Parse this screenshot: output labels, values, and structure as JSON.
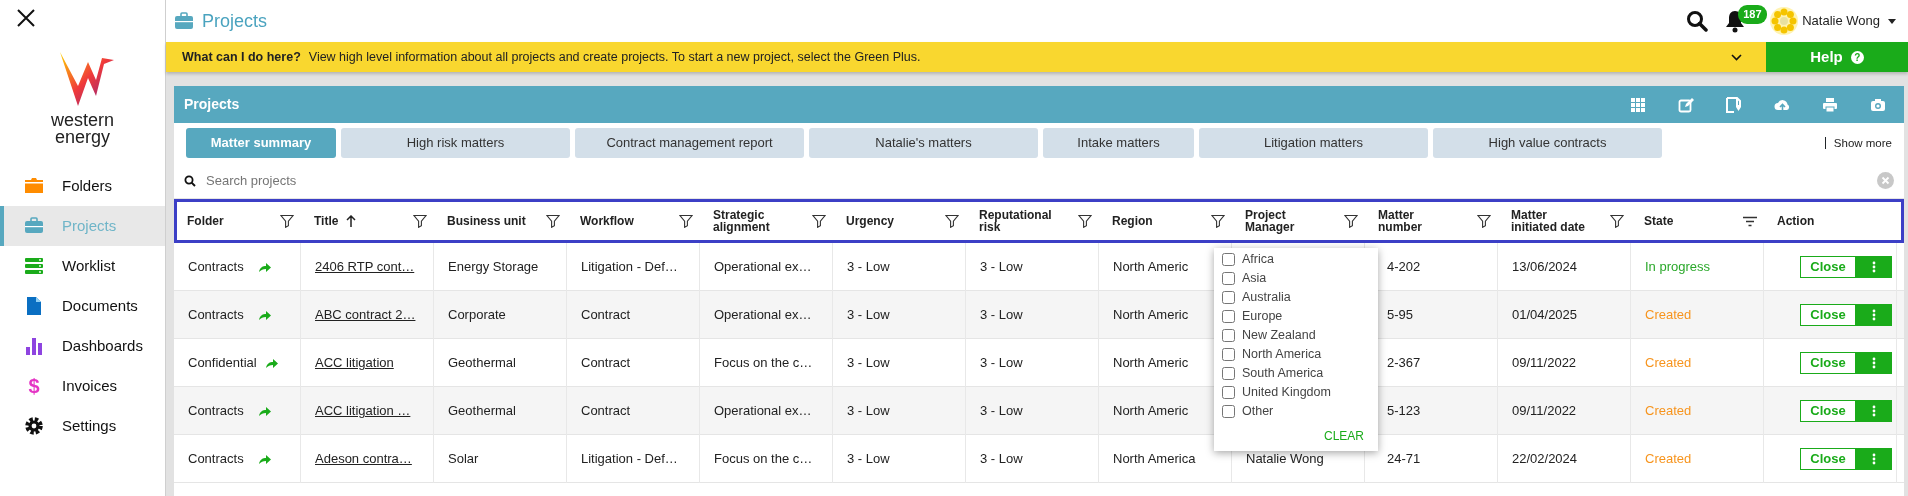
{
  "sidebar": {
    "logo": {
      "line1": "western",
      "line2": "energy"
    },
    "items": [
      {
        "label": "Folders",
        "selected": false
      },
      {
        "label": "Projects",
        "selected": true
      },
      {
        "label": "Worklist",
        "selected": false
      },
      {
        "label": "Documents",
        "selected": false
      },
      {
        "label": "Dashboards",
        "selected": false
      },
      {
        "label": "Invoices",
        "selected": false,
        "glyph": "$"
      },
      {
        "label": "Settings",
        "selected": false
      }
    ]
  },
  "top_bar": {
    "title": "Projects",
    "notification_count": "187",
    "user_name": "Natalie Wong"
  },
  "banner": {
    "lead": "What can I do here?",
    "text": "View high level information about all projects and create projects. To start a new project, select the Green Plus.",
    "help": {
      "label": "Help",
      "glyph": "?"
    }
  },
  "panel": {
    "title": "Projects",
    "tabs": [
      {
        "label": "Matter summary",
        "selected": true
      },
      {
        "label": "High risk matters",
        "selected": false
      },
      {
        "label": "Contract management report",
        "selected": false
      },
      {
        "label": "Natalie's matters",
        "selected": false
      },
      {
        "label": "Intake matters",
        "selected": false
      },
      {
        "label": "Litigation matters",
        "selected": false
      },
      {
        "label": "High value contracts",
        "selected": false
      }
    ],
    "show_more": "Show more",
    "search": {
      "placeholder": "Search projects"
    }
  },
  "table": {
    "columns": [
      {
        "label": "Folder",
        "kind": "funnel",
        "sorted": false
      },
      {
        "label": "Title",
        "kind": "funnel",
        "sorted": true
      },
      {
        "label": "Business unit",
        "kind": "funnel",
        "sorted": false
      },
      {
        "label": "Workflow",
        "kind": "funnel",
        "sorted": false
      },
      {
        "label": "Strategic alignment",
        "kind": "funnel",
        "sorted": false
      },
      {
        "label": "Urgency",
        "kind": "funnel",
        "sorted": false
      },
      {
        "label": "Reputational risk",
        "kind": "funnel",
        "sorted": false
      },
      {
        "label": "Region",
        "kind": "funnel",
        "sorted": false
      },
      {
        "label": "Project Manager",
        "kind": "funnel",
        "sorted": false
      },
      {
        "label": "Matter number",
        "kind": "funnel",
        "sorted": false
      },
      {
        "label": "Matter initiated date",
        "kind": "funnel",
        "sorted": false
      },
      {
        "label": "State",
        "kind": "lines",
        "sorted": false
      },
      {
        "label": "Action",
        "kind": "plain",
        "sorted": false
      }
    ],
    "rows": [
      {
        "folder": "Contracts",
        "title": "2406 RTP cont…",
        "business_unit": "Energy Storage",
        "workflow": "Litigation - Def…",
        "strategic_alignment": "Operational ex…",
        "urgency": "3 - Low",
        "reputational_risk": "3 - Low",
        "region": "North Americ",
        "matter_number": "4-202",
        "initiated": "13/06/2024",
        "state": "In progress",
        "color": "#2aa82a",
        "action": "Close"
      },
      {
        "folder": "Contracts",
        "title": "ABC contract 2…",
        "business_unit": "Corporate",
        "workflow": "Contract",
        "strategic_alignment": "Operational ex…",
        "urgency": "3 - Low",
        "reputational_risk": "3 - Low",
        "region": "North Americ",
        "matter_number": "5-95",
        "initiated": "01/04/2025",
        "state": "Created",
        "color": "#f7941d",
        "action": "Close"
      },
      {
        "folder": "Confidential",
        "title": "ACC litigation",
        "business_unit": "Geothermal",
        "workflow": "Contract",
        "strategic_alignment": "Focus on the c…",
        "urgency": "3 - Low",
        "reputational_risk": "3 - Low",
        "region": "North Americ",
        "matter_number": "2-367",
        "initiated": "09/11/2022",
        "state": "Created",
        "color": "#f7941d",
        "action": "Close"
      },
      {
        "folder": "Contracts",
        "title": "ACC litigation …",
        "business_unit": "Geothermal",
        "workflow": "Contract",
        "strategic_alignment": "Operational ex…",
        "urgency": "3 - Low",
        "reputational_risk": "3 - Low",
        "region": "North Americ",
        "matter_number": "5-123",
        "initiated": "09/11/2022",
        "state": "Created",
        "color": "#f7941d",
        "action": "Close"
      },
      {
        "folder": "Contracts",
        "title": "Adeson contra…",
        "business_unit": "Solar",
        "workflow": "Litigation - Def…",
        "strategic_alignment": "Focus on the c…",
        "urgency": "3 - Low",
        "reputational_risk": "3 - Low",
        "region": "North America",
        "project_manager": "Natalie Wong",
        "matter_number": "24-71",
        "initiated": "22/02/2024",
        "state": "Created",
        "color": "#f7941d",
        "action": "Close"
      }
    ],
    "region_filter": {
      "options": [
        {
          "label": "Africa",
          "checked": false
        },
        {
          "label": "Asia",
          "checked": false
        },
        {
          "label": "Australia",
          "checked": false
        },
        {
          "label": "Europe",
          "checked": false
        },
        {
          "label": "New Zealand",
          "checked": false
        },
        {
          "label": "North America",
          "checked": false
        },
        {
          "label": "South America",
          "checked": false
        },
        {
          "label": "United Kingdom",
          "checked": false
        },
        {
          "label": "Other",
          "checked": false
        }
      ],
      "clear": "CLEAR"
    }
  }
}
